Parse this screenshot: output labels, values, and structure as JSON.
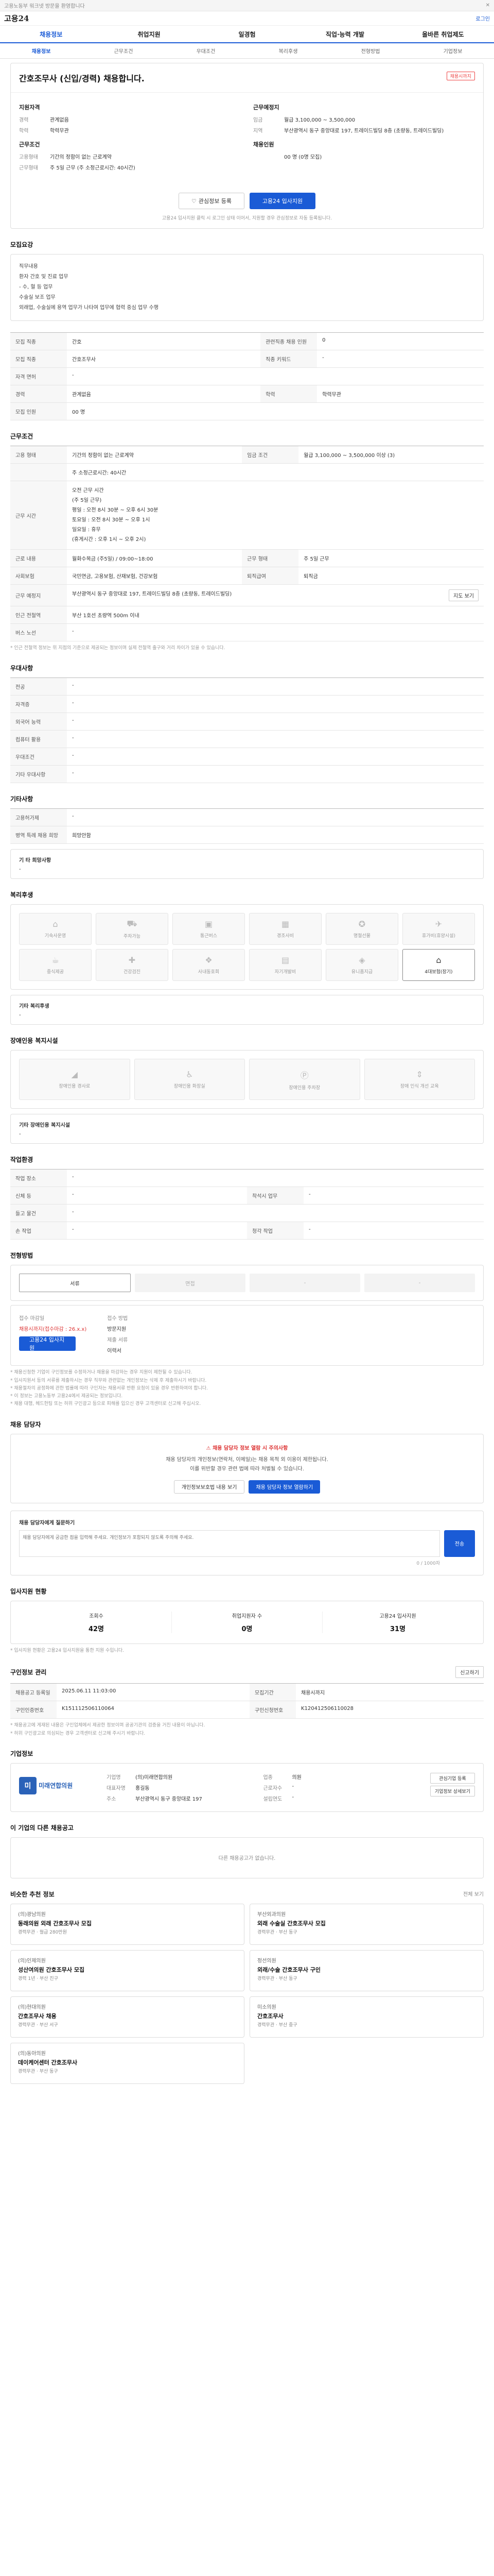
{
  "util": {
    "text": "고용노동부 워크넷 방문을 환영합니다",
    "close": "✕"
  },
  "logo": {
    "text": "고용24",
    "right": "로그인"
  },
  "gnb": [
    "채용정보",
    "취업지원",
    "일경험",
    "직업·능력 개발",
    "올바른 취업제도"
  ],
  "tabs": [
    "채용정보",
    "근무조건",
    "우대조건",
    "복리후생",
    "전형방법",
    "기업정보"
  ],
  "job": {
    "title": "간호조무사 (신입/경력) 채용합니다.",
    "badge": "채용시까지",
    "left_head": "지원자격",
    "left": [
      {
        "k": "경력",
        "v": "관계없음"
      },
      {
        "k": "학력",
        "v": "학력무관"
      }
    ],
    "left_head2": "근무조건",
    "left2": [
      {
        "k": "고용형태",
        "v": "기간의 정함이 없는 근로계약"
      },
      {
        "k": "근무형태",
        "v": "주 5일 근무 (주 소정근로시간: 40시간)"
      }
    ],
    "right_head": "근무예정지",
    "right": [
      {
        "k": "임금",
        "v": "월급 3,100,000 ~ 3,500,000"
      },
      {
        "k": "지역",
        "v": "부산광역시 동구 중앙대로 197, 트레이드빌딩 8층 (초량동, 트레이드빌딩)"
      }
    ],
    "right_head2": "채용인원",
    "right2": [
      {
        "k": "",
        "v": "00 명 (0명 모집)"
      }
    ]
  },
  "buttons": {
    "bookmark": "관심정보 등록",
    "apply": "고용24 입사지원",
    "notice": "고용24 입사지원 클릭 시 로그인 상태 이어서, 지원할 경우 관심정보로 자동 등록됩니다."
  },
  "duty": {
    "title": "모집요강",
    "lines": [
      "직무내용",
      "환자 간호 및 진료 업무",
      "- 수, 혈 등 업무",
      "수술실 보조 업무",
      "외래업, 수술실에 용역 업무가 나타여 업무에 협력 중심 업무 수행"
    ]
  },
  "recruit_table": [
    {
      "k": "모집 직종",
      "v": "간호",
      "k2": "관련직종 채용 인원",
      "v2": "0"
    },
    {
      "k": "모집 직종",
      "v": "간호조무사",
      "k2": "직종 키워드",
      "v2": "-"
    },
    {
      "k": "자격 면허",
      "v": "-",
      "k2": "",
      "v2": ""
    },
    {
      "k": "경력",
      "v": "관계없음",
      "k2": "학력",
      "v2": "학력무관"
    },
    {
      "k": "모집 인원",
      "v": "00 명",
      "k2": "",
      "v2": ""
    }
  ],
  "work": {
    "title": "근무조건",
    "rows": [
      {
        "k": "고용 형태",
        "v": "기간의 정함이 없는 근로계약",
        "k2": "임금 조건",
        "v2": "월급 3,100,000 ~ 3,500,000 이상 (3)"
      },
      {
        "k": "",
        "v": "주 소정근로시간: 40시간",
        "k2": "",
        "v2": ""
      }
    ],
    "time_head": "근무 시간",
    "time_lines": [
      "오전 근무 시간",
      "(주 5일 근무)",
      "평일 : 오전 8시 30분 ~ 오후 6시 30분",
      "토요일 : 오전 8시 30분 ~ 오후 1시",
      "일요일 : 휴무",
      "(휴게시간 : 오후 1시 ~ 오후 2시)"
    ],
    "rows2": [
      {
        "k": "근로 내용",
        "v": "월화수목금 (주5일) / 09:00~18:00",
        "k2": "근무 형태",
        "v2": "주 5일 근무"
      },
      {
        "k": "사회보험",
        "v": "국민연금, 고용보험, 산재보험, 건강보험",
        "k2": "퇴직급여",
        "v2": "퇴직금"
      },
      {
        "k": "근무 예정지",
        "v": "부산광역시 동구 중앙대로 197, 트레이드빌딩 8층 (초량동, 트레이드빌딩)",
        "k2": "",
        "v2": ""
      },
      {
        "k": "인근 전철역",
        "v": "부산 1호선 초량역 500m 이내",
        "k2": "",
        "v2": ""
      },
      {
        "k": "버스 노선",
        "v": "-",
        "k2": "",
        "v2": ""
      }
    ],
    "map_btn": "지도 보기",
    "note": "* 인근 전철역 정보는 위 지점의 기준으로 제공되는 정보이며 실제 전철역 출구와 거리 차이가 있을 수 있습니다."
  },
  "pref": {
    "title": "우대사항",
    "rows": [
      {
        "k": "전공",
        "v": "-"
      },
      {
        "k": "자격증",
        "v": "-"
      },
      {
        "k": "외국어 능력",
        "v": "-"
      },
      {
        "k": "컴퓨터 활용",
        "v": "-"
      },
      {
        "k": "우대조건",
        "v": "-"
      },
      {
        "k": "기타 우대사항",
        "v": "-"
      }
    ]
  },
  "etc": {
    "title": "기타사항",
    "rows": [
      {
        "k": "고용허가제",
        "v": "-"
      },
      {
        "k": "병역 특례 채용 희망",
        "v": "희망안함"
      }
    ],
    "sub_title": "기 타 희망사항",
    "sub_text": "-"
  },
  "welfare": {
    "title": "복리후생",
    "items": [
      {
        "icon": "home-icon",
        "label": "기숙사운영",
        "on": false
      },
      {
        "icon": "car-icon",
        "label": "주차가능",
        "on": false
      },
      {
        "icon": "bus-icon",
        "label": "통근버스",
        "on": false
      },
      {
        "icon": "calendar-icon",
        "label": "경조사비",
        "on": false
      },
      {
        "icon": "award-icon",
        "label": "명절선물",
        "on": false
      },
      {
        "icon": "plane-icon",
        "label": "휴가비(휴양시설)",
        "on": false
      },
      {
        "icon": "meal-icon",
        "label": "중식제공",
        "on": false
      },
      {
        "icon": "health-icon",
        "label": "건강검진",
        "on": false
      },
      {
        "icon": "gift-icon",
        "label": "사내동호회",
        "on": false
      },
      {
        "icon": "book-icon",
        "label": "자기개발비",
        "on": false
      },
      {
        "icon": "uniform-icon",
        "label": "유니폼지급",
        "on": false
      },
      {
        "icon": "home-icon",
        "label": "4대보험(장기)",
        "on": true
      }
    ],
    "sub_title": "기타 복리후생",
    "sub_text": "-"
  },
  "disabled": {
    "title": "장애인용 복지시설",
    "items": [
      {
        "icon": "ramp-icon",
        "label": "장애인용 경사로",
        "on": false
      },
      {
        "icon": "toilet-icon",
        "label": "장애인용 화장실",
        "on": false
      },
      {
        "icon": "parking-icon",
        "label": "장애인용 주차장",
        "on": false
      },
      {
        "icon": "elevator-icon",
        "label": "장애 인식 개선 교육",
        "on": false
      }
    ],
    "sub_title": "기타 장애인용 복지시설",
    "sub_text": "-"
  },
  "env": {
    "title": "작업환경",
    "rows": [
      {
        "k": "작업 장소",
        "v": "-",
        "k2": "",
        "v2": ""
      },
      {
        "k": "신체 등",
        "v": "-",
        "k2": "착석시 업무",
        "v2": "-"
      },
      {
        "k": "들고 물건",
        "v": "-",
        "k2": "",
        "v2": ""
      },
      {
        "k": "손 작업",
        "v": "-",
        "k2": "청각 작업",
        "v2": "-"
      }
    ]
  },
  "process": {
    "title": "전형방법",
    "steps": [
      "서류",
      "면접",
      "-",
      "-"
    ],
    "m_left_title": "접수 마감일",
    "m_left_value": "채용시까지(접수마감 : 26.x.x)",
    "m_left_btn": "고용24 입사지원",
    "m_right_title": "접수 방법",
    "m_right_value": "방문지원",
    "m_right_title2": "제출 서류",
    "m_right_value2": "이력서",
    "notes": [
      "* 채용신청한 기업이 구인정보를 수정하거나 채용을 마감하는 경우 지원이 제한될 수 있습니다.",
      "* 입사지원서 등의 서류를 제출하시는 경우 직무와 관련없는 개인정보는 삭제 후 제출하시기 바랍니다.",
      "* 채용절차의 공정화에 관한 법률에 따라 구인자는 채용서류 반환 요청이 있을 경우 반환하여야 합니다.",
      "* 이 정보는 고용노동부 고용24에서 제공되는 정보입니다.",
      "* 채용 대행, 헤드헌팅 또는 허위 구인광고 등으로 피해를 입으신 경우 고객센터로 신고해 주십시오."
    ]
  },
  "contact": {
    "title": "채용 담당자",
    "warn": "채용 담당자 정보 열람 시 주의사항",
    "p1": "채용 담당자의 개인정보(연락처, 이메일)는 채용 목적 외 이용이 제한됩니다.",
    "p2": "이를 위반할 경우 관련 법에 따라 처벌될 수 있습니다.",
    "btn1": "개인정보보호법 내용 보기",
    "btn2": "채용 담당자 정보 열람하기",
    "qna_title": "채용 담당자에게 질문하기",
    "qna_placeholder": "채용 담당자에게 궁금한 점을 입력해 주세요. 개인정보가 포함되지 않도록 주의해 주세요.",
    "qna_send": "전송",
    "qna_counter": "0 / 1000자"
  },
  "stats": {
    "title": "입사지원 현황",
    "items": [
      {
        "label": "조회수",
        "value": "42명"
      },
      {
        "label": "취업지원자 수",
        "value": "0명"
      },
      {
        "label": "고용24 입사지원",
        "value": "31명"
      }
    ],
    "note": "* 입사지원 현황은 고용24 입사지원을 통한 지원 수입니다."
  },
  "info": {
    "title": "구인정보 관리",
    "report": "신고하기",
    "rows": [
      {
        "k": "채용공고 등록일",
        "v": "2025.06.11 11:03:00",
        "k2": "모집기간",
        "v2": "채용시까지"
      },
      {
        "k": "구인인증번호",
        "v": "K151112506110064",
        "k2": "구인신청번호",
        "v2": "K120412506110028"
      }
    ],
    "notes": [
      "* 채용공고에 게재된 내용은 구인업체에서 제공한 정보이며 공공기관의 검증을 거친 내용이 아닙니다.",
      "* 허위 구인광고로 의심되는 경우 고객센터로 신고해 주시기 바랍니다."
    ]
  },
  "company": {
    "title": "기업정보",
    "logo_mark": "미",
    "logo_name": "미래연합의원",
    "rows": [
      {
        "k": "기업명",
        "v": "(의)미래연합의원",
        "k2": "업종",
        "v2": "의원"
      },
      {
        "k": "대표자명",
        "v": "홍길동",
        "k2": "근로자수",
        "v2": "-"
      },
      {
        "k": "주소",
        "v": "부산광역시 동구 중앙대로 197",
        "k2": "설립연도",
        "v2": "-"
      }
    ],
    "btn1": "관심기업 등록",
    "btn2": "기업정보 상세보기"
  },
  "other": {
    "title": "이 기업의 다른 채용공고",
    "empty": "다른 채용공고가 없습니다."
  },
  "recommend": {
    "title": "비슷한 추천 정보",
    "right": "전체 보기",
    "items": [
      {
        "co": "(의)광남의원",
        "title": "동래의원 외래 간호조무사 모집",
        "meta": "경력무관 · 월급 280만원"
      },
      {
        "co": "부산외과의원",
        "title": "외래 수술실 간호조무사 모집",
        "meta": "경력무관 · 부산 동구"
      },
      {
        "co": "(의)인제의원",
        "title": "성산여의원 간호조무사 모집",
        "meta": "경력 1년 · 부산 진구"
      },
      {
        "co": "정선의원",
        "title": "외래/수술 간호조무사 구인",
        "meta": "경력무관 · 부산 동구"
      },
      {
        "co": "(의)현대의원",
        "title": "간호조무사 채용",
        "meta": "경력무관 · 부산 서구"
      },
      {
        "co": "미소의원",
        "title": "간호조무사",
        "meta": "경력무관 · 부산 중구"
      },
      {
        "co": "(의)동아의원",
        "title": "데이케어센터 간호조무사",
        "meta": "경력무관 · 부산 동구"
      }
    ]
  }
}
